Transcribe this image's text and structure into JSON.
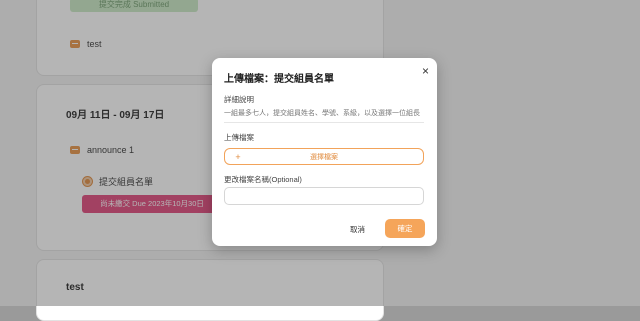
{
  "background": {
    "card1": {
      "submitted_badge": "提交完成  Submitted",
      "item_label": "test"
    },
    "card2": {
      "week_title": "09月 11日 - 09月 17日",
      "announce_label": "announce 1",
      "assignment_label": "提交組員名單",
      "due_badge": "尚未繳交  Due 2023年10月30日"
    },
    "card3": {
      "title": "test"
    }
  },
  "modal": {
    "title": "上傳檔案：提交組員名單",
    "close_symbol": "×",
    "details_label": "詳細說明",
    "details_text": "一組最多七人，提交組員姓名、學號、系級，以及選擇一位組長",
    "upload_label": "上傳檔案",
    "upload_plus": "+",
    "upload_button": "選擇檔案",
    "rename_label": "更改檔案名稱(Optional)",
    "rename_value": "",
    "cancel_button": "取消",
    "confirm_button": "確定"
  },
  "colors": {
    "accent": "#f5a55a",
    "due_badge": "#e0447a",
    "submitted_badge": "#c9e9c4"
  }
}
